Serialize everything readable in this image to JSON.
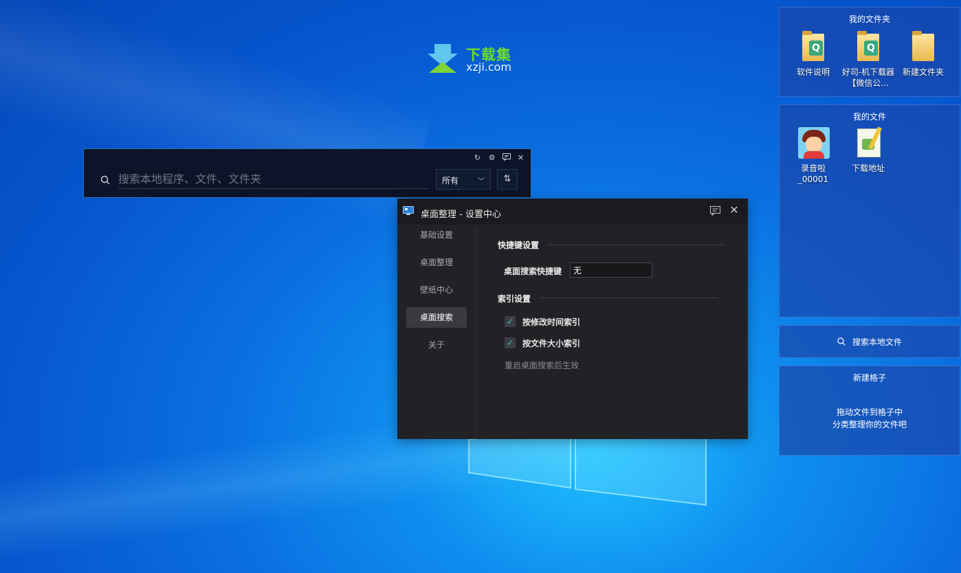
{
  "watermark": {
    "title": "下载集",
    "subtitle": "xzji.com"
  },
  "search_bar": {
    "placeholder": "搜索本地程序、文件、文件夹",
    "filter_value": "所有",
    "tool_icons": [
      "refresh-icon",
      "gear-icon",
      "feedback-icon",
      "close-icon"
    ],
    "sort_icon": "sort-icon"
  },
  "settings": {
    "title": "桌面整理 - 设置中心",
    "nav": [
      "基础设置",
      "桌面整理",
      "壁纸中心",
      "桌面搜索",
      "关于"
    ],
    "active_nav": "桌面搜索",
    "shortcut_section": "快捷键设置",
    "shortcut_label": "桌面搜索快捷键",
    "shortcut_value": "无",
    "index_section": "索引设置",
    "options": [
      {
        "label": "按修改时间索引",
        "checked": true
      },
      {
        "label": "按文件大小索引",
        "checked": true
      }
    ],
    "note": "重启桌面搜索后生效",
    "accent_color": "#2bd0c0"
  },
  "panels": {
    "my_folders": {
      "title": "我的文件夹",
      "items": [
        {
          "label": "软件说明",
          "icon": "folder-icon"
        },
        {
          "label": "好司-机下载器【微信公...",
          "icon": "folder-icon"
        },
        {
          "label": "新建文件夹",
          "icon": "folder-icon"
        }
      ]
    },
    "my_files": {
      "title": "我的文件",
      "items": [
        {
          "label": "录音啦_00001",
          "icon": "avatar-image-icon"
        },
        {
          "label": "下载地址",
          "icon": "text-document-icon"
        }
      ]
    },
    "search_panel": {
      "label": "搜索本地文件"
    },
    "new_grid": {
      "title": "新建格子",
      "hint_line1": "拖动文件到格子中",
      "hint_line2": "分类整理你的文件吧"
    }
  }
}
